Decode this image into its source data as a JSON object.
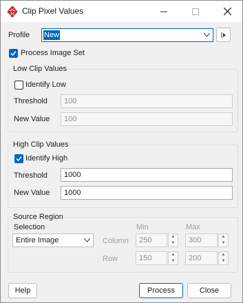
{
  "window": {
    "title": "Clip Pixel Values"
  },
  "profile": {
    "label": "Profile",
    "value": "New"
  },
  "process_image_set": {
    "label": "Process Image Set",
    "checked": true
  },
  "low_clip": {
    "title": "Low Clip Values",
    "identify_label": "Identify Low",
    "identify_checked": false,
    "threshold_label": "Threshold",
    "threshold_value": "100",
    "new_value_label": "New Value",
    "new_value_value": "100"
  },
  "high_clip": {
    "title": "High Clip Values",
    "identify_label": "Identify High",
    "identify_checked": true,
    "threshold_label": "Threshold",
    "threshold_value": "1000",
    "new_value_label": "New Value",
    "new_value_value": "1000"
  },
  "source_region": {
    "title": "Source Region",
    "selection_label": "Selection",
    "selection_value": "Entire Image",
    "min_header": "Min",
    "max_header": "Max",
    "column_label": "Column",
    "row_label": "Row",
    "column_min": "250",
    "column_max": "300",
    "row_min": "150",
    "row_max": "200"
  },
  "buttons": {
    "help": "Help",
    "process": "Process",
    "close": "Close"
  },
  "colors": {
    "accent": "#0067c0",
    "icon_red": "#c0282d"
  }
}
